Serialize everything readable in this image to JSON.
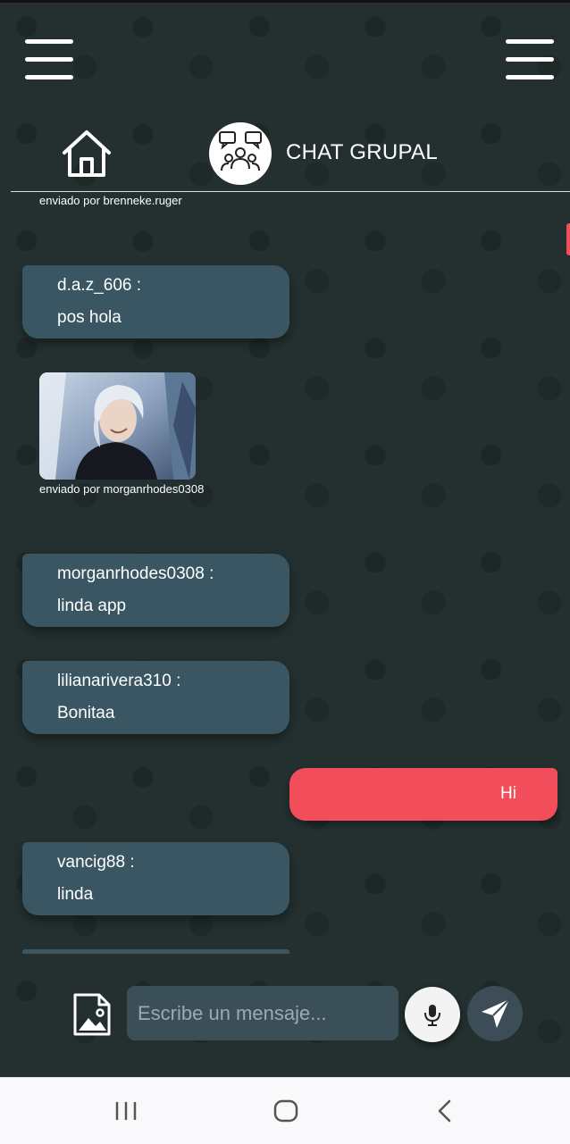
{
  "header": {
    "title": "CHAT GRUPAL",
    "left_menu_icon": "hamburger-menu-icon",
    "right_menu_icon": "hamburger-menu-icon",
    "home_icon": "home-icon",
    "chat_logo_icon": "group-chat-icon"
  },
  "messages": [
    {
      "type": "caption",
      "text": "enviado por brenneke.ruger"
    },
    {
      "type": "text",
      "user": "d.a.z_606 :",
      "text": "pos hola"
    },
    {
      "type": "image",
      "caption": "enviado por morganrhodes0308"
    },
    {
      "type": "text",
      "user": "morganrhodes0308 :",
      "text": "linda app"
    },
    {
      "type": "text",
      "user": "lilianarivera310 :",
      "text": "Bonitaa"
    },
    {
      "type": "own",
      "text": "Hi"
    },
    {
      "type": "text",
      "user": "vancig88 :",
      "text": "linda"
    }
  ],
  "composer": {
    "placeholder": "Escribe un mensaje...",
    "gallery_icon": "image-gallery-icon",
    "mic_icon": "microphone-icon",
    "send_icon": "send-icon"
  },
  "colors": {
    "background": "#23302f",
    "incoming_bubble": "#3a5663",
    "outgoing_bubble": "#f14d5b",
    "input_background": "#3a4f57"
  },
  "navbar": {
    "recent_icon": "recent-apps-icon",
    "home_icon": "home-circle-icon",
    "back_icon": "back-chevron-icon"
  }
}
